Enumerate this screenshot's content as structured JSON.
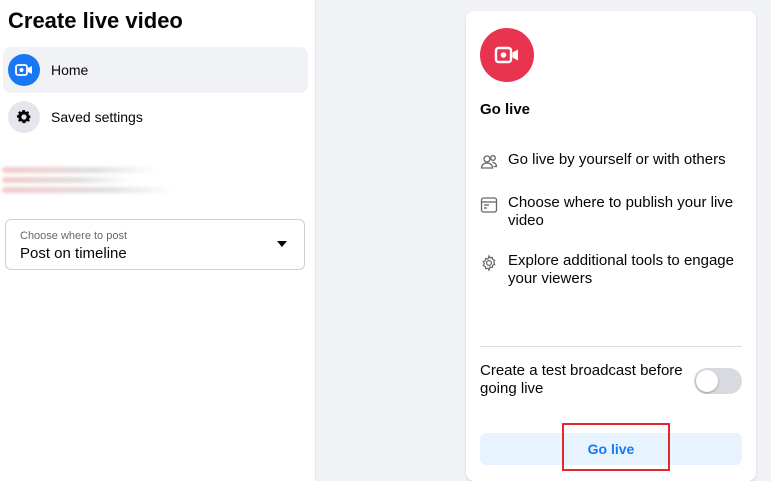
{
  "page": {
    "title": "Create live video"
  },
  "sidebar": {
    "items": [
      {
        "label": "Home",
        "icon": "live-camera-icon",
        "active": true
      },
      {
        "label": "Saved settings",
        "icon": "gear-icon",
        "active": false
      }
    ]
  },
  "post_select": {
    "caption": "Choose where to post",
    "value": "Post on timeline"
  },
  "card": {
    "badge_icon": "live-video-icon",
    "title": "Go live",
    "features": [
      {
        "icon": "people-icon",
        "text": "Go live by yourself or with others"
      },
      {
        "icon": "browser-window-icon",
        "text": "Choose where to publish your live video"
      },
      {
        "icon": "gear-icon",
        "text": "Explore additional tools to engage your viewers"
      }
    ],
    "test_broadcast": {
      "label": "Create a test broadcast before going live",
      "enabled": false
    },
    "go_live_button": "Go live"
  },
  "colors": {
    "accent": "#1877f2",
    "live_red": "#e8344e",
    "highlight_red": "#e0282e",
    "button_bg": "#e7f3ff"
  }
}
